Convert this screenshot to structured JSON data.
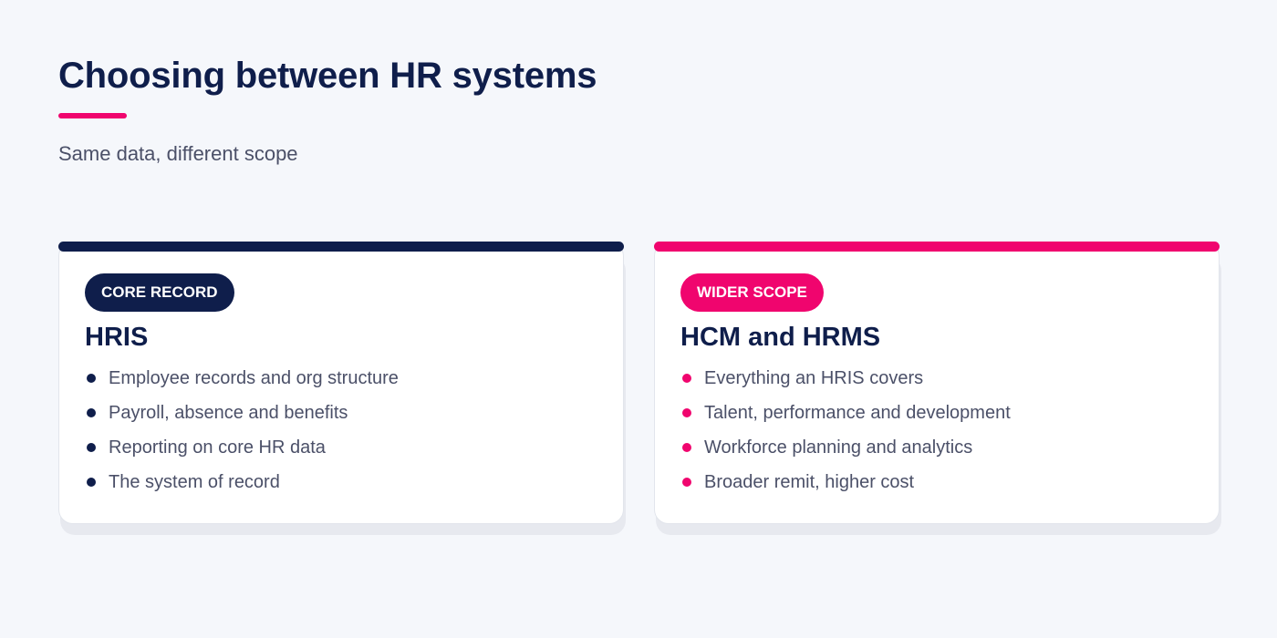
{
  "title": "Choosing between HR systems",
  "subtitle": "Same data, different scope",
  "colors": {
    "navy": "#0f1e4b",
    "pink": "#f0056e",
    "background": "#f5f7fb",
    "text_muted": "#4b5068"
  },
  "cards": [
    {
      "badge": "CORE RECORD",
      "heading": "HRIS",
      "accent": "navy",
      "bullets": [
        "Employee records and org structure",
        "Payroll, absence and benefits",
        "Reporting on core HR data",
        "The system of record"
      ]
    },
    {
      "badge": "WIDER SCOPE",
      "heading": "HCM and HRMS",
      "accent": "pink",
      "bullets": [
        "Everything an HRIS covers",
        "Talent, performance and development",
        "Workforce planning and analytics",
        "Broader remit, higher cost"
      ]
    }
  ]
}
